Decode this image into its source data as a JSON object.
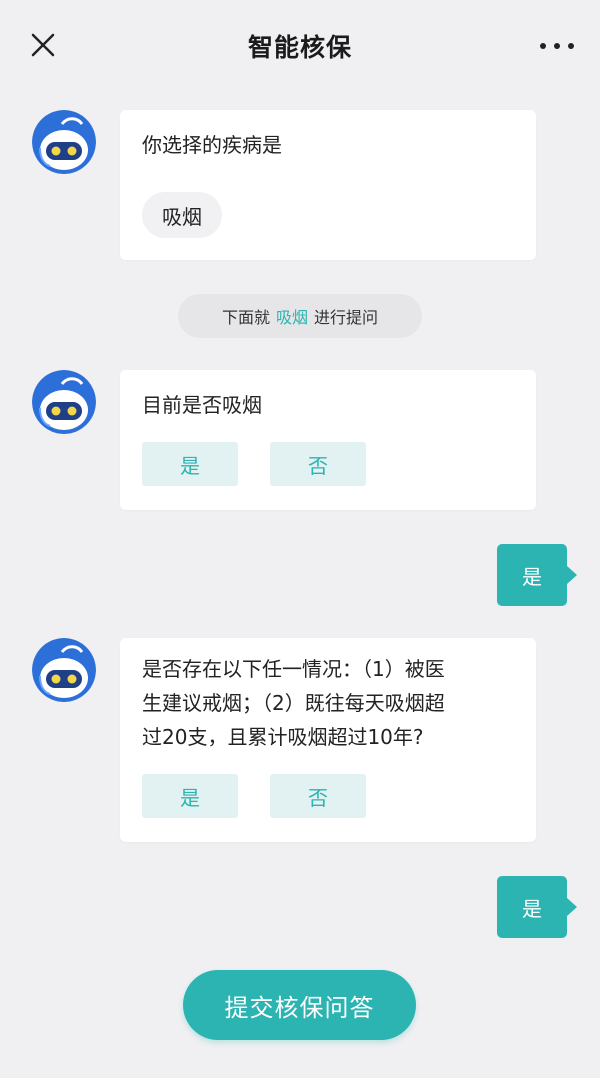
{
  "header": {
    "title": "智能核保",
    "close_icon": "close-icon",
    "more_icon": "more-icon"
  },
  "messages": {
    "selected": {
      "text": "你选择的疾病是",
      "chip": "吸烟"
    },
    "notice": {
      "prefix": "下面就",
      "highlight": "吸烟",
      "suffix": "进行提问"
    },
    "q1": {
      "text": "目前是否吸烟",
      "yes": "是",
      "no": "否"
    },
    "reply1": "是",
    "q2": {
      "line1": "是否存在以下任一情况：（1）被医",
      "line2": "生建议戒烟；（2）既往每天吸烟超",
      "line3": "过20支，且累计吸烟超过10年?",
      "yes": "是",
      "no": "否"
    },
    "reply2": "是"
  },
  "submit_label": "提交核保问答",
  "colors": {
    "accent": "#2bb4b1",
    "background": "#f0f0f3",
    "option_bg": "#e2f2f2",
    "avatar_blue": "#2d6fd8"
  }
}
